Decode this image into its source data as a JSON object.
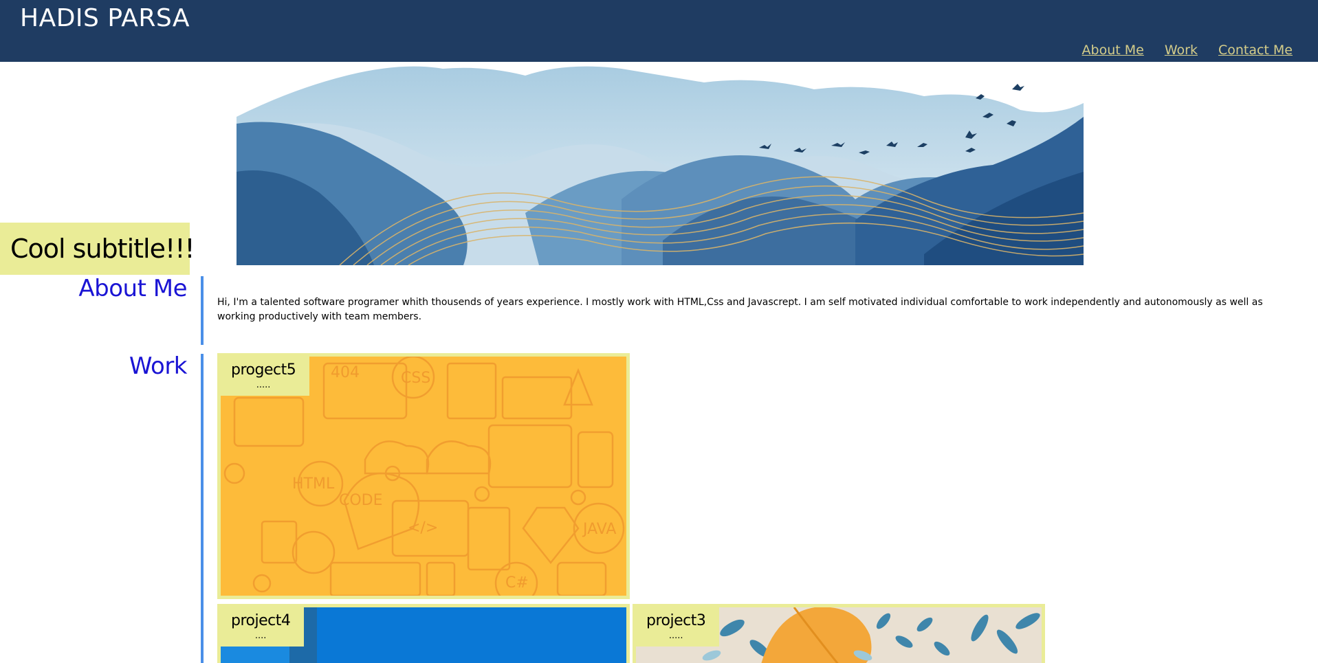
{
  "header": {
    "brand": "HADIS PARSA",
    "nav": [
      {
        "label": "About Me"
      },
      {
        "label": "Work"
      },
      {
        "label": "Contact Me"
      }
    ]
  },
  "hero": {
    "subtitle": "Cool subtitle!!!"
  },
  "about": {
    "title": "About Me",
    "text": "Hi, I'm a talented software programer whith thousends of years experience. I mostly work with HTML,Css and Javascrept. I am self motivated individual comfortable to work independently and autonomously as well as working productively with team members."
  },
  "work": {
    "title": "Work",
    "projects": [
      {
        "title": "progect5",
        "desc": "....."
      },
      {
        "title": "project4",
        "desc": "...."
      },
      {
        "title": "project3",
        "desc": "....."
      }
    ]
  },
  "pattern_words": [
    "404",
    "CSS",
    "HTML",
    "CODE",
    "JAVA",
    "C#",
    "</>"
  ],
  "colors": {
    "header_bg": "#1f3c62",
    "nav_link": "#d4cd8a",
    "accent_yellow": "#eaec97",
    "section_title": "#1a14d4",
    "section_bar": "#4a8fe8",
    "pattern_bg": "#fdbb3a"
  }
}
